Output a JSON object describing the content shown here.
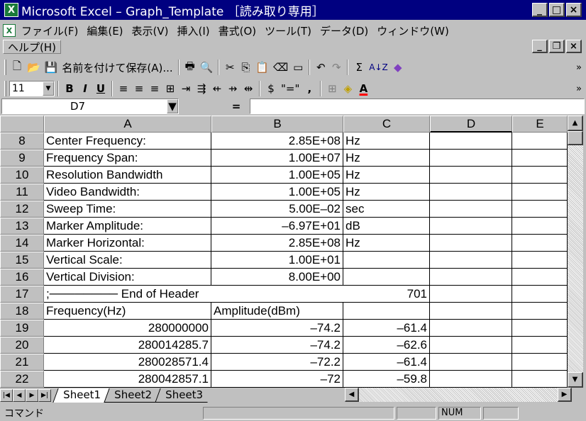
{
  "window": {
    "title": "Microsoft Excel – Graph_Template ［読み取り専用］",
    "app_icon": "excel-icon",
    "controls": {
      "minimize": "_",
      "maximize": "□",
      "close": "×"
    }
  },
  "menubar": {
    "items": [
      "ファイル(F)",
      "編集(E)",
      "表示(V)",
      "挿入(I)",
      "書式(O)",
      "ツール(T)",
      "データ(D)",
      "ウィンドウ(W)"
    ],
    "help": "ヘルプ(H)",
    "doc_controls": {
      "minimize": "_",
      "restore": "❐",
      "close": "×"
    }
  },
  "toolbar_standard": {
    "new": "🗋",
    "open": "📂",
    "save": "💾",
    "save_as_label": "名前を付けて保存(A)...",
    "print": "🖶",
    "preview": "🔍",
    "cut": "✂",
    "copy": "⎘",
    "paste": "📋",
    "eraser": "⌫",
    "insert": "▭",
    "undo": "↶",
    "redo": "↷",
    "autosum": "Σ",
    "sort": "A↓Z",
    "chart": "◆",
    "more": "»"
  },
  "toolbar_format": {
    "font_size": "11",
    "bold": "B",
    "italic": "I",
    "underline": "U",
    "align_left": "≡",
    "align_center": "≡",
    "align_right": "≡",
    "merge": "⊞",
    "icons": [
      "⇥",
      "⇶",
      "⇷",
      "⇸",
      "⇹"
    ],
    "currency": "$",
    "style": "\"=\"",
    "comma": ",",
    "borders": "⊞",
    "fill": "◈",
    "font_color": "A",
    "more": "»"
  },
  "formula_bar": {
    "name_box": "D7",
    "equals": "=",
    "formula": ""
  },
  "columns": [
    "A",
    "B",
    "C",
    "D",
    "E"
  ],
  "rows": [
    {
      "n": "8",
      "a": "Center Frequency:",
      "b": "2.85E+08",
      "c": "Hz",
      "d": ""
    },
    {
      "n": "9",
      "a": "Frequency Span:",
      "b": "1.00E+07",
      "c": "Hz",
      "d": ""
    },
    {
      "n": "10",
      "a": "Resolution Bandwidth",
      "b": "1.00E+05",
      "c": "Hz",
      "d": ""
    },
    {
      "n": "11",
      "a": "Video Bandwidth:",
      "b": "1.00E+05",
      "c": "Hz",
      "d": ""
    },
    {
      "n": "12",
      "a": "Sweep Time:",
      "b": "5.00E–02",
      "c": "sec",
      "d": ""
    },
    {
      "n": "13",
      "a": "Marker Amplitude:",
      "b": "–6.97E+01",
      "c": "dB",
      "d": ""
    },
    {
      "n": "14",
      "a": "Marker Horizontal:",
      "b": "2.85E+08",
      "c": "Hz",
      "d": ""
    },
    {
      "n": "15",
      "a": "Vertical Scale:",
      "b": "1.00E+01",
      "c": "",
      "d": ""
    },
    {
      "n": "16",
      "a": "Vertical Division:",
      "b": "8.00E+00",
      "c": "",
      "d": ""
    },
    {
      "n": "17",
      "a": ";──────── End of Header",
      "b": "",
      "c": "701",
      "d": ""
    },
    {
      "n": "18",
      "a": "Frequency(Hz)",
      "b": "Amplitude(dBm)",
      "c": "",
      "d": ""
    },
    {
      "n": "19",
      "a": "280000000",
      "b": "–74.2",
      "c": "–61.4",
      "d": ""
    },
    {
      "n": "20",
      "a": "280014285.7",
      "b": "–74.2",
      "c": "–62.6",
      "d": ""
    },
    {
      "n": "21",
      "a": "280028571.4",
      "b": "–72.2",
      "c": "–61.4",
      "d": ""
    },
    {
      "n": "22",
      "a": "280042857.1",
      "b": "–72",
      "c": "–59.8",
      "d": ""
    }
  ],
  "sheets": [
    "Sheet1",
    "Sheet2",
    "Sheet3"
  ],
  "active_sheet": "Sheet1",
  "statusbar": {
    "mode": "コマンド",
    "num": "NUM"
  }
}
